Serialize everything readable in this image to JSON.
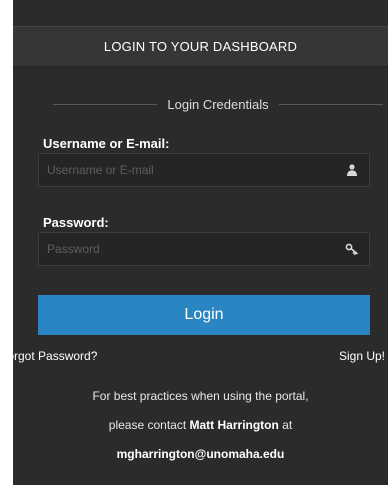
{
  "header": {
    "title": "LOGIN TO YOUR DASHBOARD"
  },
  "credentials": {
    "legend": "Login Credentials",
    "username": {
      "label": "Username or E-mail:",
      "placeholder": "Username or E-mail",
      "value": "",
      "icon": "user-icon"
    },
    "password": {
      "label": "Password:",
      "placeholder": "Password",
      "value": "",
      "icon": "key-icon"
    }
  },
  "actions": {
    "login_label": "Login",
    "forgot_label": "Forgot Password?",
    "signup_label": "Sign Up!"
  },
  "info": {
    "line1": "For best practices when using the portal,",
    "line2_prefix": "please contact ",
    "contact_name": "Matt Harrington",
    "line2_suffix": " at",
    "contact_email": "mgharrington@unomaha.edu"
  },
  "colors": {
    "panel_bg": "#2b2b2b",
    "header_bg": "#363636",
    "accent": "#2a86c2",
    "input_bg": "#252525"
  }
}
